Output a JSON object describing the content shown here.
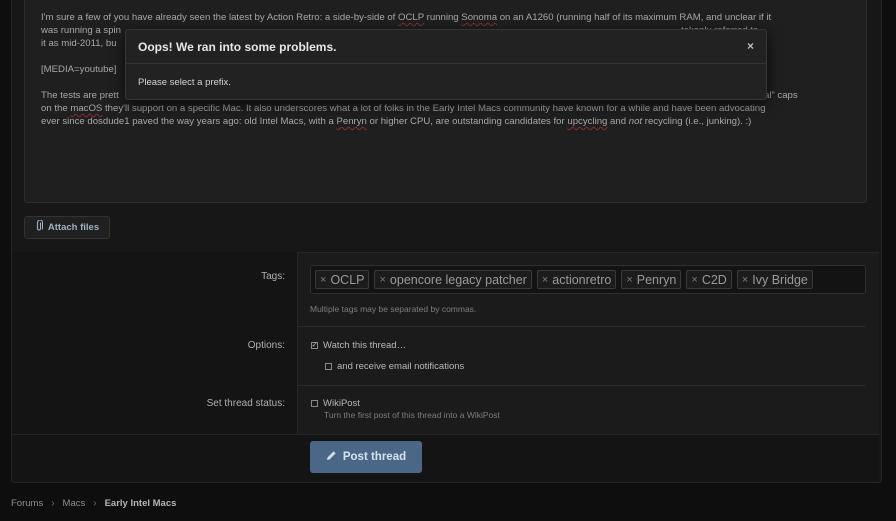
{
  "editor": {
    "p1_a": "I'm sure a few of you have already seen the latest by Action Retro: a side-by-side of ",
    "p1_oclp": "OCLP",
    "p1_b": " running ",
    "p1_sonoma": "Sonoma",
    "p1_c": " on an A1260 (running half of its maximum RAM, and unclear if it",
    "p2_a": "was running a spin",
    "p2_gap": "",
    "p2_b": "takenly referred to",
    "p3": "it as mid-2011, bu",
    "media": "[MEDIA=youtube]",
    "p4_a": "The tests are prett",
    "p4_b": "set “official” caps",
    "p5_a": "on the ",
    "p5_macos": "macOS",
    "p5_b": " they'll support on a specific Mac. It also underscores what a lot of folks in the Early Intel Macs community have known for a while and have been advocating",
    "p6_a": "ever since dosdude1 paved the way years ago: old Intel Macs, with a ",
    "p6_penryn": "Penryn",
    "p6_b": " or higher CPU, are outstanding candidates for ",
    "p6_upcycling": "upcycling",
    "p6_c": " and ",
    "p6_not": "not",
    "p6_d": " recycling (i.e., junking). :)"
  },
  "attach": {
    "label": "Attach files",
    "icon": "paperclip-icon"
  },
  "tags": {
    "label": "Tags:",
    "items": [
      "OCLP",
      "opencore legacy patcher",
      "actionretro",
      "Penryn",
      "C2D",
      "Ivy Bridge"
    ],
    "remove_glyph": "×",
    "hint": "Multiple tags may be separated by commas."
  },
  "options": {
    "label": "Options:",
    "watch": "Watch this thread…",
    "email": "and receive email notifications"
  },
  "status": {
    "label": "Set thread status:",
    "wikipost": "WikiPost",
    "hint": "Turn the first post of this thread into a WikiPost"
  },
  "post_button": {
    "label": "Post thread",
    "icon": "pencil-icon"
  },
  "breadcrumbs": [
    "Forums",
    "Macs",
    "Early Intel Macs"
  ],
  "modal": {
    "title": "Oops! We ran into some problems.",
    "close": "×",
    "message": "Please select a prefix."
  },
  "colors": {
    "accent": "#4a6788",
    "background": "#171717"
  }
}
